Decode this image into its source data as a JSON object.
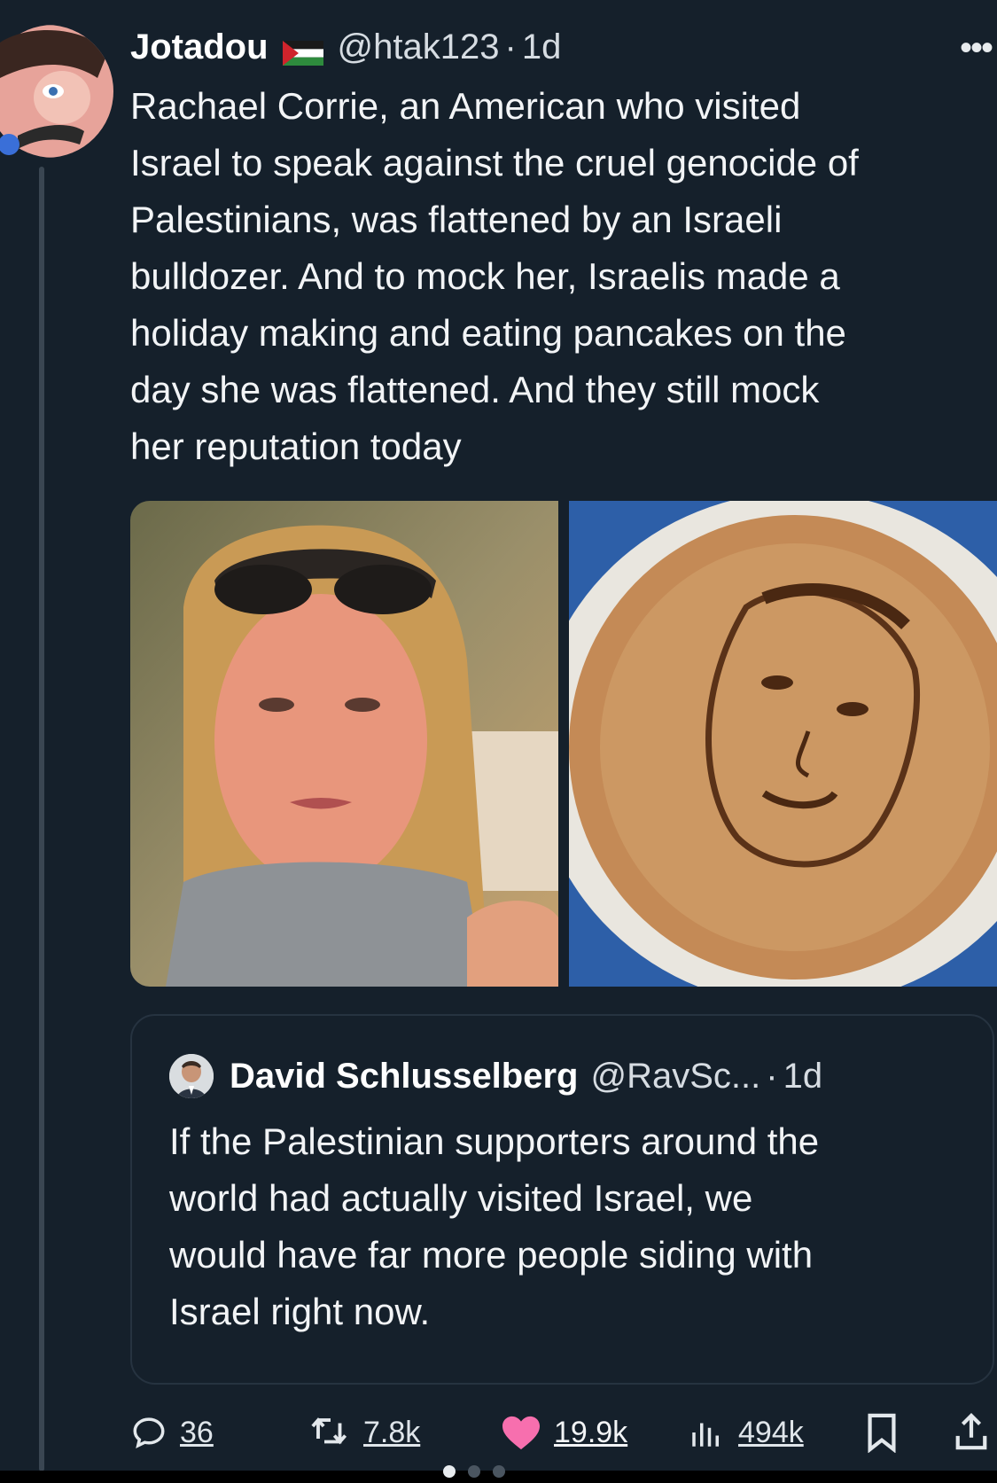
{
  "tweet": {
    "display_name": "Jotadou",
    "handle": "@htak123",
    "separator": "·",
    "time": "1d",
    "text": "Rachael Corrie, an American who visited\nIsrael to speak against the cruel genocide of\nPalestinians, was flattened by an Israeli\nbulldozer. And to mock her, Israelis made a\nholiday making and eating pancakes on the\nday she was flattened. And they still mock\nher reputation today",
    "more_icon": "more-horizontal-icon",
    "flag_icon": "palestine-flag-icon"
  },
  "quoted_tweet": {
    "display_name": "David Schlusselberg",
    "handle": "@RavSc...",
    "separator": "·",
    "time": "1d",
    "text": "If the Palestinian supporters around the\nworld had actually visited Israel, we\nwould have far more people siding with\nIsrael right now."
  },
  "actions": {
    "replies": "36",
    "reposts": "7.8k",
    "likes": "19.9k",
    "views": "494k"
  },
  "colors": {
    "background": "#15202b",
    "like": "#f76fae",
    "text": "#f2f4f6"
  }
}
